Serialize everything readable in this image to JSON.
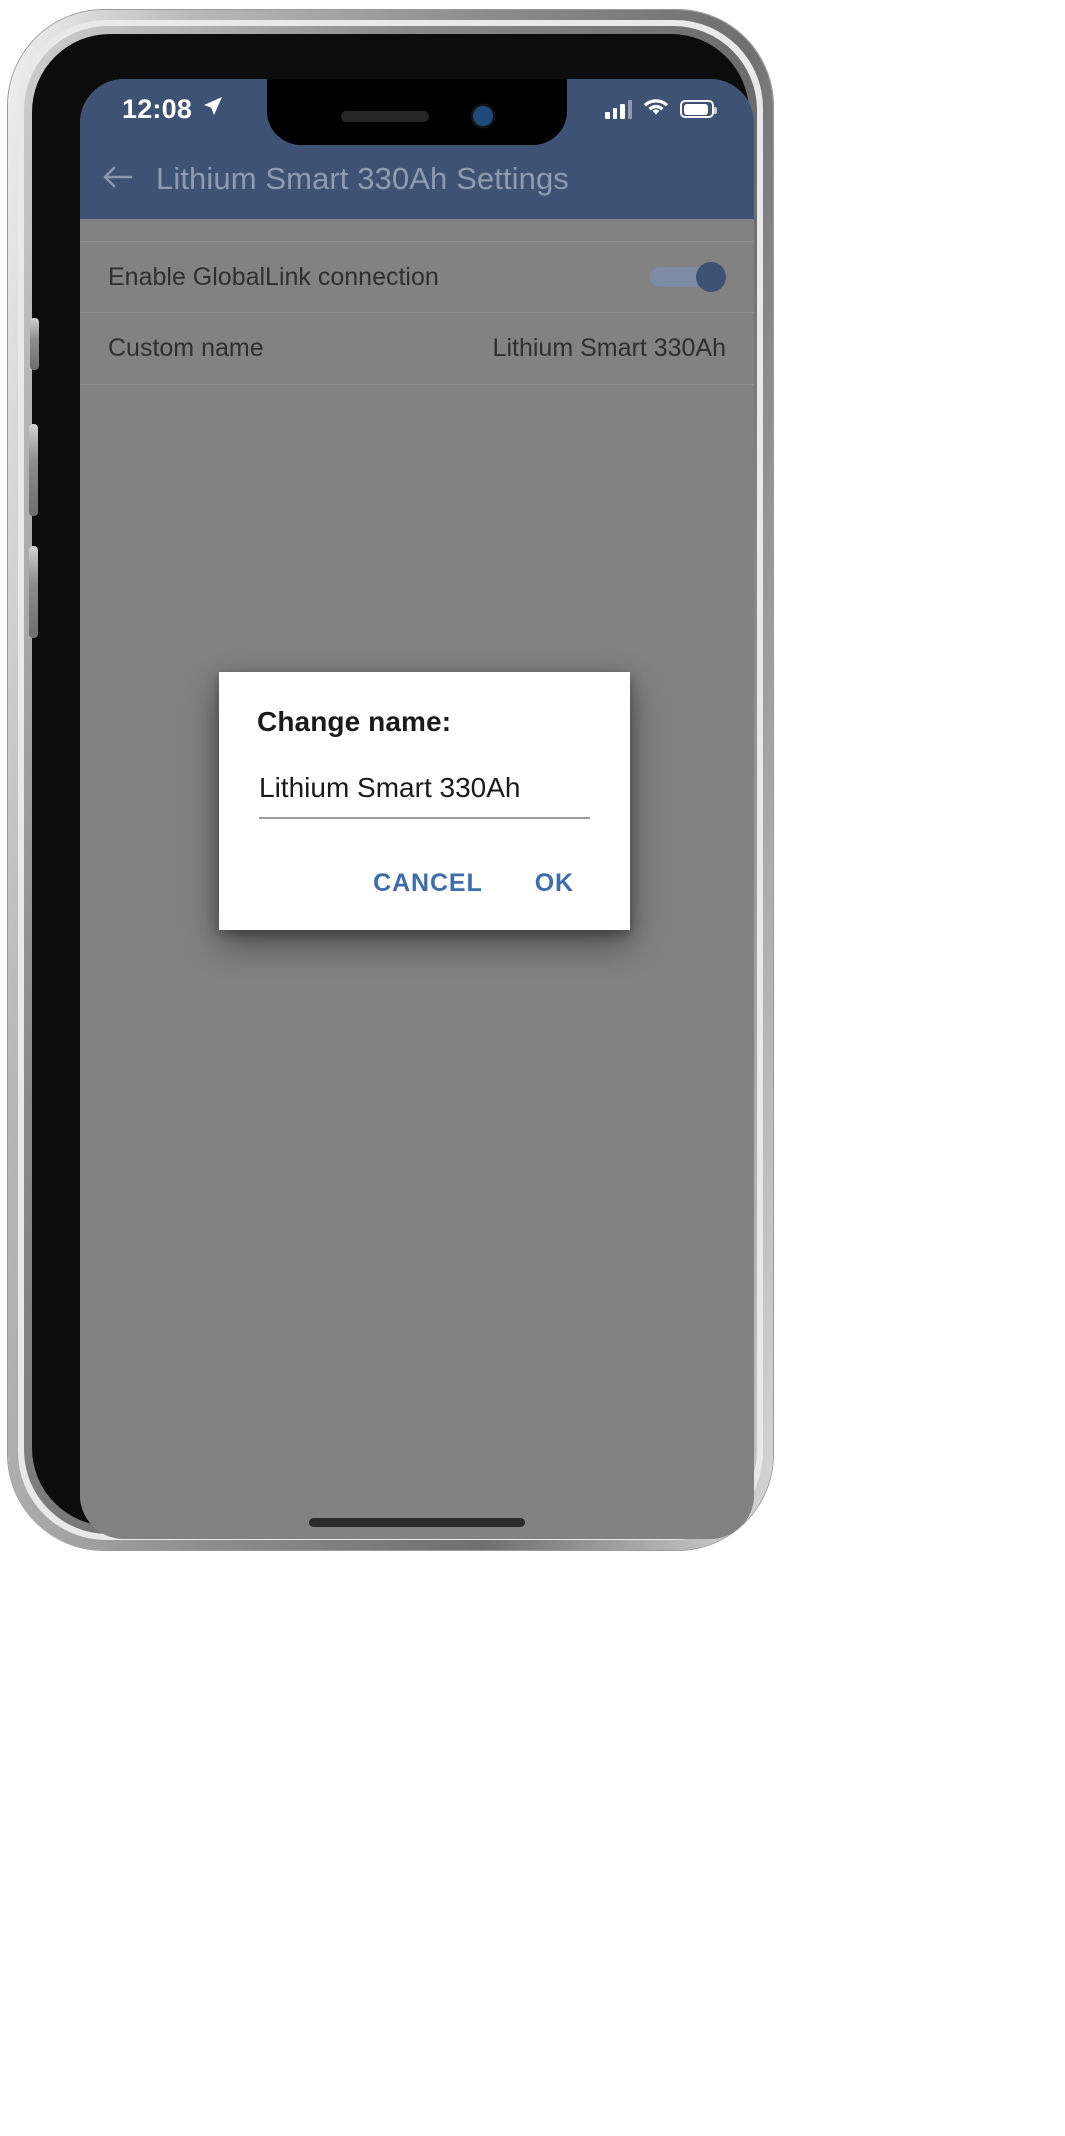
{
  "status_bar": {
    "time": "12:08",
    "location_icon": "location-arrow-icon",
    "signal_icon": "cellular-signal-icon",
    "wifi_icon": "wifi-icon",
    "battery_icon": "battery-icon"
  },
  "header": {
    "back_icon": "back-arrow-icon",
    "title": "Lithium Smart 330Ah Settings",
    "background_color": "#3e5274",
    "title_color": "#8f9cb0"
  },
  "settings": {
    "rows": [
      {
        "label": "Enable GlobalLink connection",
        "control": "toggle",
        "value": "on"
      },
      {
        "label": "Custom name",
        "control": "value",
        "value": "Lithium Smart 330Ah"
      }
    ]
  },
  "dialog": {
    "title": "Change name:",
    "input_value": "Lithium Smart 330Ah",
    "input_placeholder": "Lithium Smart 330Ah",
    "cancel_label": "CANCEL",
    "ok_label": "OK",
    "accent_color": "#3f6cab"
  }
}
